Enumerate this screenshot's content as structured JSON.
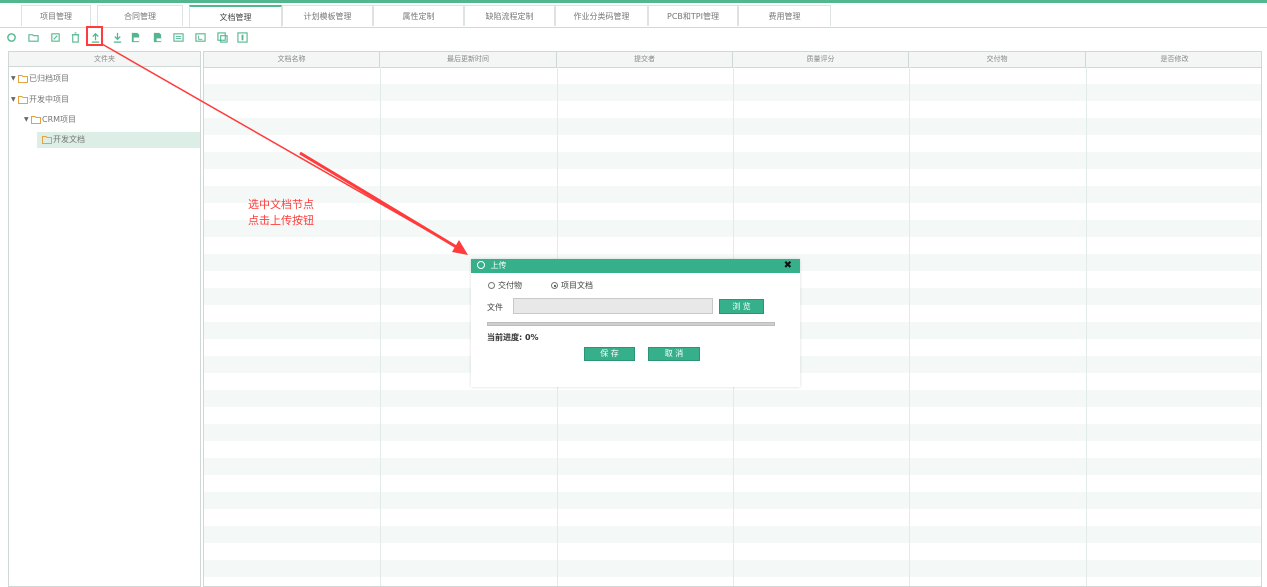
{
  "tabs": [
    "项目管理",
    "合同管理",
    "文档管理",
    "计划模板管理",
    "属性定制",
    "缺陷流程定制",
    "作业分类码管理",
    "PCB和TPI管理",
    "费用管理"
  ],
  "active_tab": "文档管理",
  "toolbar_icons": [
    "refresh-icon",
    "new-folder-icon",
    "edit-icon",
    "delete-icon",
    "upload-icon",
    "download-icon",
    "doc-icon",
    "doc-alt-icon",
    "list-icon",
    "import-icon",
    "export-icon",
    "view-icon"
  ],
  "tree": {
    "header": "文件夹",
    "nodes": [
      {
        "label": "已归档项目"
      },
      {
        "label": "开发中项目"
      },
      {
        "label": "CRM项目"
      },
      {
        "label": "开发文档"
      }
    ]
  },
  "grid": {
    "columns": [
      "文档名称",
      "最后更新时间",
      "提交者",
      "质量评分",
      "交付物",
      "是否修改"
    ]
  },
  "annotation": {
    "line1": "选中文档节点",
    "line2": "点击上传按钮"
  },
  "dialog": {
    "title": "上传",
    "radio1": "交付物",
    "radio2": "项目文档",
    "radio_selected": "项目文档",
    "file_label": "文件",
    "file_value": "",
    "browse": "浏 览",
    "progress_label": "当前进度: 0%",
    "progress": 0,
    "save": "保 存",
    "cancel": "取 消"
  },
  "colors": {
    "accent": "#35b08a",
    "annotation": "#ff3b3b"
  }
}
